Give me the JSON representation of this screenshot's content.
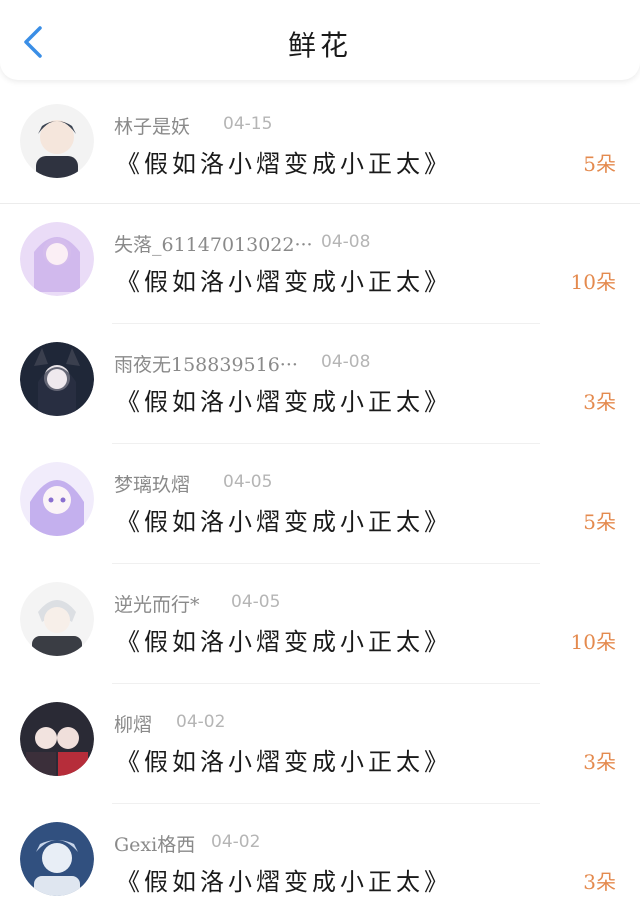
{
  "header": {
    "title": "鲜花",
    "back_icon": "chevron-left-icon",
    "accent": "#3a8ee6"
  },
  "list": {
    "items": [
      {
        "user": "林子是妖",
        "date": "04-15",
        "book": "《假如洛小熠变成小正太》",
        "amount": "5朵",
        "avatar_color": "#5a6b80"
      },
      {
        "user": "失落_61147013022···",
        "date": "04-08",
        "book": "《假如洛小熠变成小正太》",
        "amount": "10朵",
        "avatar_color": "#d9c3ee"
      },
      {
        "user": "雨夜无158839516···",
        "date": "04-08",
        "book": "《假如洛小熠变成小正太》",
        "amount": "3朵",
        "avatar_color": "#2b3a55"
      },
      {
        "user": "梦璃玖熠",
        "date": "04-05",
        "book": "《假如洛小熠变成小正太》",
        "amount": "5朵",
        "avatar_color": "#c9b6f0"
      },
      {
        "user": "逆光而行*",
        "date": "04-05",
        "book": "《假如洛小熠变成小正太》",
        "amount": "10朵",
        "avatar_color": "#9aa0a8"
      },
      {
        "user": "柳熠",
        "date": "04-02",
        "book": "《假如洛小熠变成小正太》",
        "amount": "3朵",
        "avatar_color": "#7a3540"
      },
      {
        "user": "Gexi格西",
        "date": "04-02",
        "book": "《假如洛小熠变成小正太》",
        "amount": "3朵",
        "avatar_color": "#3f5d8c"
      }
    ]
  },
  "colors": {
    "amount": "#e48a4e",
    "name": "#8a8a8a",
    "date": "#b5b5b5"
  }
}
